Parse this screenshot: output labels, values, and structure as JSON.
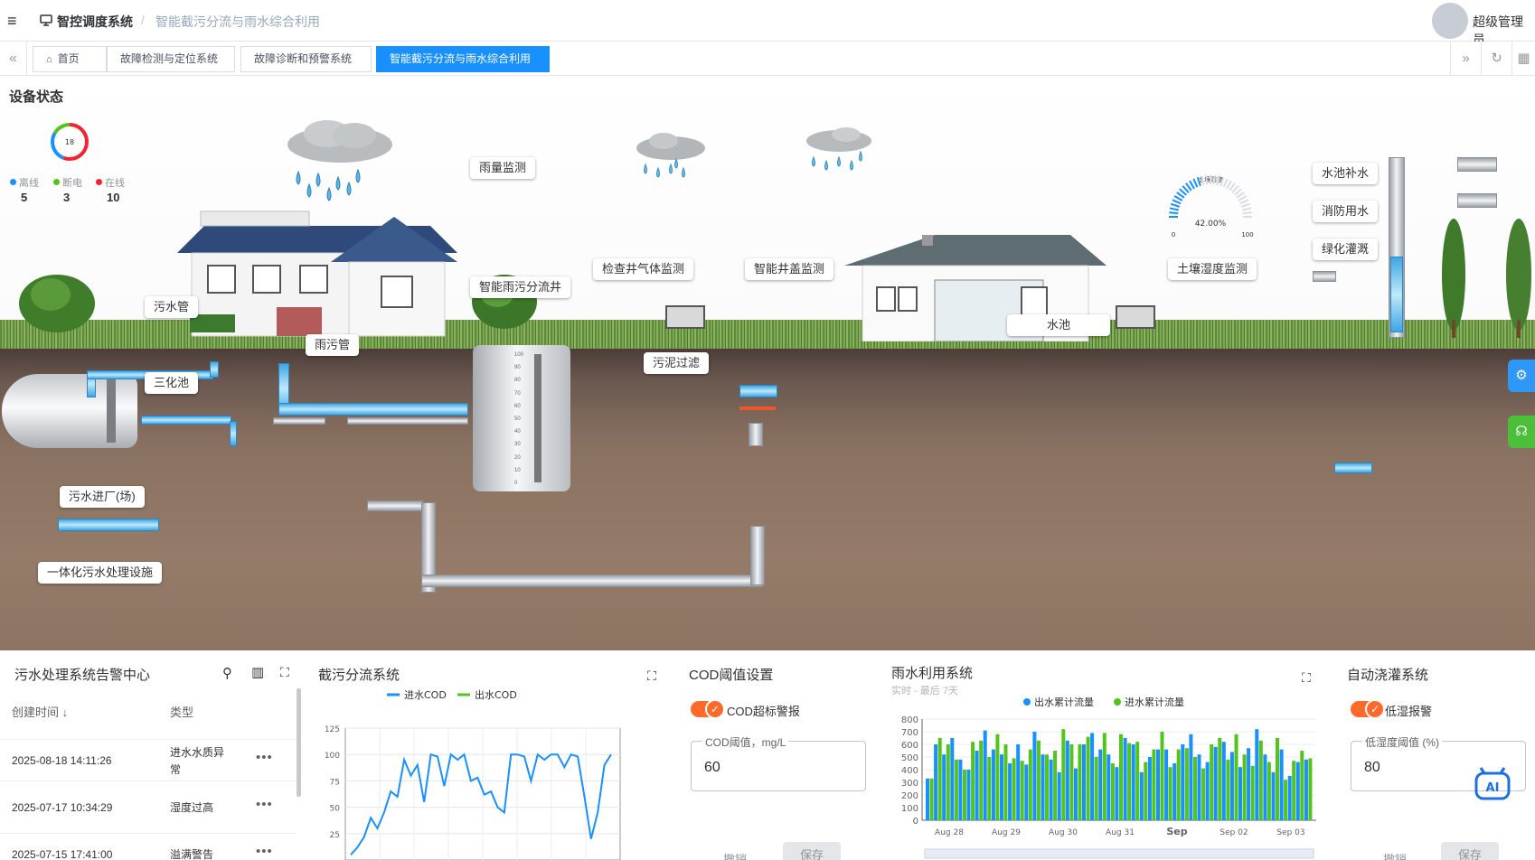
{
  "topbar": {
    "menu_icon": "hamburger-icon",
    "brand": "智控调度系统",
    "separator": "/",
    "crumb": "智能截污分流与雨水综合利用",
    "user": "超级管理员"
  },
  "tabs": {
    "items": [
      {
        "label": "首页"
      },
      {
        "label": "故障检测与定位系统"
      },
      {
        "label": "故障诊断和预警系统"
      },
      {
        "label": "智能截污分流与雨水综合利用"
      }
    ],
    "active": 3
  },
  "scene": {
    "title": "设备状态",
    "total": "18",
    "legend": [
      {
        "label": "离线",
        "value": "5",
        "color": "#1890ff"
      },
      {
        "label": "断电",
        "value": "3",
        "color": "#52c41a"
      },
      {
        "label": "在线",
        "value": "10",
        "color": "#f5222d"
      }
    ],
    "labels": {
      "rain": "雨量监测",
      "sewage_pipe": "污水管",
      "mixed_pipe": "雨污管",
      "septic": "三化池",
      "smart_well": "智能雨污分流井",
      "gas": "检查井气体监测",
      "cover": "智能井盖监测",
      "sludge": "污泥过滤",
      "pool": "水池",
      "soil": "土壤湿度监测",
      "refill": "水池补水",
      "fire": "消防用水",
      "irrigation": "绿化灌溉",
      "plant_in": "污水进厂(场)",
      "facility": "一体化污水处理设施"
    },
    "gauge": {
      "title": "土壤湿度",
      "value": "42.00%",
      "min": "0",
      "max": "100",
      "fraction": 0.42
    },
    "tank_ticks": [
      "100",
      "90",
      "80",
      "70",
      "60",
      "50",
      "40",
      "30",
      "20",
      "10",
      "0"
    ]
  },
  "alarm": {
    "title": "污水处理系统告警中心",
    "col_time": "创建时间",
    "col_type": "类型",
    "rows": [
      {
        "time": "2025-08-18 14:11:26",
        "type": "进水水质异常"
      },
      {
        "time": "2025-07-17 10:34:29",
        "type": "湿度过高"
      },
      {
        "time": "2025-07-15 17:41:00",
        "type": "溢满警告"
      }
    ],
    "more": "•••"
  },
  "diversion": {
    "title": "截污分流系统"
  },
  "cod": {
    "title": "COD阈值设置",
    "switch_label": "COD超标警报",
    "field_label": "COD阈值，mg/L",
    "field_value": "60",
    "cancel": "撤销",
    "save": "保存"
  },
  "rainuse": {
    "title": "雨水利用系统",
    "subtitle": "实时 - 最后 7天"
  },
  "irrigate": {
    "title": "自动浇灌系统",
    "switch_label": "低湿报警",
    "field_label": "低湿度阈值 (%)",
    "field_value": "80",
    "cancel": "撤销",
    "save": "保存"
  },
  "chart_data": [
    {
      "type": "line",
      "title": "截污分流系统",
      "series": [
        {
          "name": "进水COD",
          "color": "#1890ff",
          "values": [
            5,
            12,
            22,
            40,
            30,
            45,
            65,
            60,
            95,
            80,
            90,
            55,
            100,
            98,
            70,
            100,
            95,
            100,
            75,
            78,
            62,
            65,
            50,
            45,
            100,
            100,
            98,
            75,
            100,
            95,
            100,
            100,
            88,
            100,
            98,
            60,
            20,
            45,
            90,
            100
          ]
        },
        {
          "name": "出水COD",
          "color": "#52c41a",
          "values": []
        }
      ],
      "ylim": [
        0,
        125
      ],
      "yticks": [
        "125",
        "100",
        "75",
        "50",
        "25"
      ],
      "grid": true,
      "legend": "top"
    },
    {
      "type": "bar",
      "title": "雨水利用系统",
      "series": [
        {
          "name": "出水累计流量",
          "color": "#1890ff",
          "values": [
            330,
            600,
            520,
            650,
            480,
            400,
            550,
            710,
            560,
            520,
            450,
            600,
            440,
            700,
            520,
            480,
            380,
            630,
            410,
            600,
            690,
            560,
            520,
            420,
            650,
            600,
            380,
            500,
            560,
            560,
            450,
            600,
            680,
            520,
            460,
            580,
            620,
            540,
            420,
            570,
            720,
            520,
            380,
            560,
            350,
            460,
            480
          ]
        },
        {
          "name": "进水累计流量",
          "color": "#52c41a",
          "values": [
            330,
            650,
            600,
            480,
            400,
            620,
            630,
            500,
            680,
            600,
            490,
            470,
            560,
            630,
            520,
            550,
            720,
            600,
            600,
            660,
            500,
            690,
            450,
            680,
            610,
            620,
            460,
            560,
            700,
            420,
            560,
            570,
            500,
            410,
            600,
            650,
            480,
            680,
            520,
            430,
            630,
            460,
            650,
            320,
            470,
            550,
            490
          ]
        }
      ],
      "xticks": [
        "Aug 28",
        "Aug 29",
        "Aug 30",
        "Aug 31",
        "Sep",
        "Sep 02",
        "Sep 03"
      ],
      "yticks": [
        "800",
        "700",
        "600",
        "500",
        "400",
        "300",
        "200",
        "100",
        "0"
      ],
      "ylim": [
        0,
        800
      ],
      "legend": "top"
    }
  ],
  "colors": {
    "accent": "#1890ff",
    "pipe_blue": "#3fa7e0",
    "switch": "#ff6a2b"
  }
}
